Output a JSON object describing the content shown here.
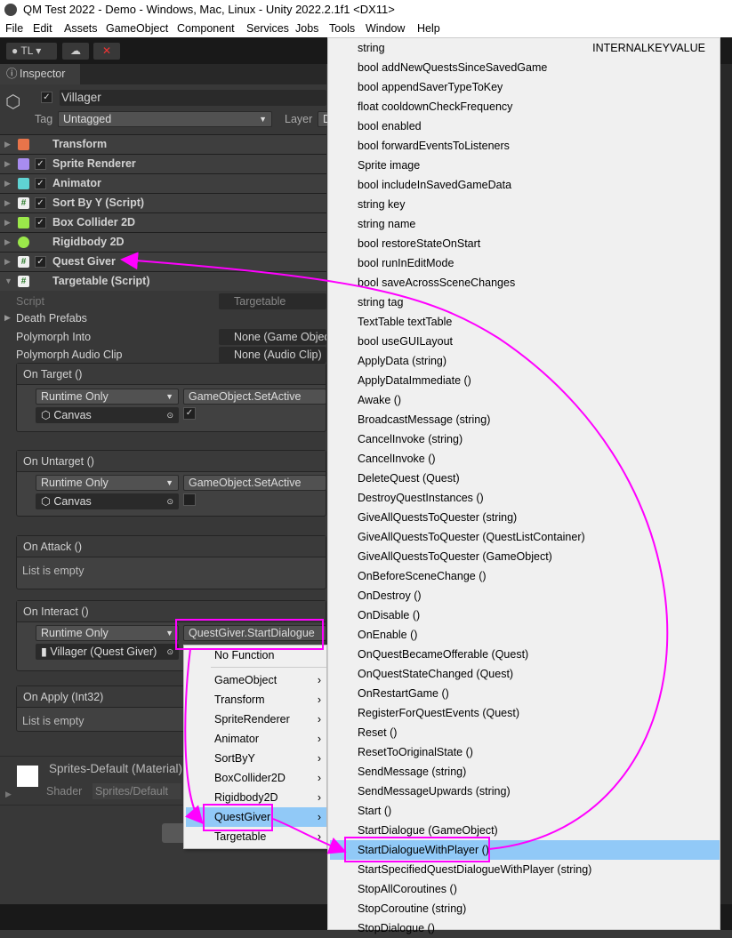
{
  "window": {
    "title": "QM Test 2022 - Demo - Windows, Mac, Linux - Unity 2022.2.1f1 <DX11>"
  },
  "menubar": [
    "File",
    "Edit",
    "Assets",
    "GameObject",
    "Component",
    "Services",
    "Jobs",
    "Tools",
    "Window",
    "Help"
  ],
  "toolbar": {
    "account": "TL"
  },
  "inspector": {
    "tab": "Inspector",
    "object_name": "Villager",
    "tag_label": "Tag",
    "tag_value": "Untagged",
    "layer_label": "Layer",
    "layer_value": "D",
    "components": [
      {
        "name": "Transform",
        "checkbox": false,
        "icon": "transform-icon"
      },
      {
        "name": "Sprite Renderer",
        "checkbox": true,
        "icon": "sprite-renderer-icon"
      },
      {
        "name": "Animator",
        "checkbox": true,
        "icon": "animator-icon"
      },
      {
        "name": "Sort By Y (Script)",
        "checkbox": true,
        "icon": "script-icon"
      },
      {
        "name": "Box Collider 2D",
        "checkbox": true,
        "icon": "box-collider-icon"
      },
      {
        "name": "Rigidbody 2D",
        "checkbox": false,
        "icon": "rigidbody-icon"
      },
      {
        "name": "Quest Giver",
        "checkbox": true,
        "icon": "script-icon"
      },
      {
        "name": "Targetable (Script)",
        "checkbox": false,
        "icon": "script-icon"
      }
    ],
    "fields": {
      "script_label": "Script",
      "script_value": "Targetable",
      "death_prefabs": "Death Prefabs",
      "polymorph_into": "Polymorph Into",
      "polymorph_into_value": "None (Game Object)",
      "polymorph_audio": "Polymorph Audio Clip",
      "polymorph_audio_value": "None (Audio Clip)"
    },
    "events": {
      "on_target": {
        "title": "On Target ()",
        "mode": "Runtime Only",
        "function": "GameObject.SetActive",
        "object": "Canvas",
        "checked": true
      },
      "on_untarget": {
        "title": "On Untarget ()",
        "mode": "Runtime Only",
        "function": "GameObject.SetActive",
        "object": "Canvas",
        "checked": false
      },
      "on_attack": {
        "title": "On Attack ()",
        "empty": "List is empty"
      },
      "on_interact": {
        "title": "On Interact ()",
        "mode": "Runtime Only",
        "function": "QuestGiver.StartDialogue",
        "object": "Villager (Quest Giver)"
      },
      "on_apply": {
        "title": "On Apply (Int32)",
        "empty": "List is empty"
      }
    },
    "material": {
      "name": "Sprites-Default (Material)",
      "shader_label": "Shader",
      "shader_value": "Sprites/Default"
    }
  },
  "submenu": {
    "items": [
      "No Function",
      "GameObject",
      "Transform",
      "SpriteRenderer",
      "Animator",
      "SortByY",
      "BoxCollider2D",
      "Rigidbody2D",
      "QuestGiver",
      "Targetable"
    ],
    "highlighted": "QuestGiver"
  },
  "function_menu": {
    "first_item_right": "INTERNALKEYVALUE",
    "highlighted": "StartDialogueWithPlayer ()",
    "items": [
      "string",
      "bool addNewQuestsSinceSavedGame",
      "bool appendSaverTypeToKey",
      "float cooldownCheckFrequency",
      "bool enabled",
      "bool forwardEventsToListeners",
      "Sprite image",
      "bool includeInSavedGameData",
      "string key",
      "string name",
      "bool restoreStateOnStart",
      "bool runInEditMode",
      "bool saveAcrossSceneChanges",
      "string tag",
      "TextTable textTable",
      "bool useGUILayout",
      "ApplyData (string)",
      "ApplyDataImmediate ()",
      "Awake ()",
      "BroadcastMessage (string)",
      "CancelInvoke (string)",
      "CancelInvoke ()",
      "DeleteQuest (Quest)",
      "DestroyQuestInstances ()",
      "GiveAllQuestsToQuester (string)",
      "GiveAllQuestsToQuester (QuestListContainer)",
      "GiveAllQuestsToQuester (GameObject)",
      "OnBeforeSceneChange ()",
      "OnDestroy ()",
      "OnDisable ()",
      "OnEnable ()",
      "OnQuestBecameOfferable (Quest)",
      "OnQuestStateChanged (Quest)",
      "OnRestartGame ()",
      "RegisterForQuestEvents (Quest)",
      "Reset ()",
      "ResetToOriginalState ()",
      "SendMessage (string)",
      "SendMessageUpwards (string)",
      "Start ()",
      "StartDialogue (GameObject)",
      "StartDialogueWithPlayer ()",
      "StartSpecifiedQuestDialogueWithPlayer (string)",
      "StopAllCoroutines ()",
      "StopCoroutine (string)",
      "StopDialogue ()"
    ]
  },
  "colors": {
    "annotation": "#ff00ff",
    "highlight": "#91c9f7",
    "panel": "#383838"
  }
}
